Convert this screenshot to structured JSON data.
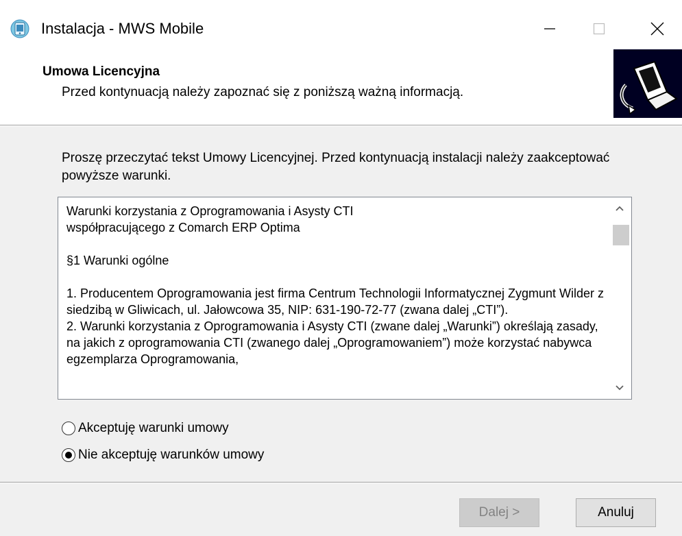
{
  "window": {
    "title": "Instalacja - MWS Mobile",
    "icon": "installer-app-icon",
    "controls": [
      "minimize-icon",
      "maximize-icon",
      "close-icon"
    ]
  },
  "header": {
    "title": "Umowa Licencyjna",
    "subtitle": "Przed kontynuacją należy zapoznać się z poniższą ważną informacją.",
    "image": "computer-install-icon"
  },
  "intro": "Proszę przeczytać tekst Umowy Licencyjnej. Przed kontynuacją instalacji należy zaakceptować powyższe warunki.",
  "license": {
    "text": "Warunki korzystania z Oprogramowania i Asysty CTI\nwspółpracującego z Comarch ERP Optima\n\n§1 Warunki ogólne\n\n1. Producentem Oprogramowania jest firma Centrum Technologii Informatycznej Zygmunt Wilder z siedzibą w Gliwicach, ul. Jałowcowa 35, NIP: 631-190-72-77 (zwana dalej „CTI”).\n2. Warunki korzystania z Oprogramowania i Asysty CTI (zwane dalej „Warunki”) określają zasady, na jakich z oprogramowania CTI (zwanego dalej „Oprogramowaniem”) może korzystać nabywca egzemplarza Oprogramowania,"
  },
  "options": {
    "accept_label": "Akceptuję warunki umowy",
    "decline_label": "Nie akceptuję warunków umowy",
    "selected": "decline"
  },
  "buttons": {
    "next_label": "Dalej >",
    "cancel_label": "Anuluj"
  },
  "colors": {
    "disabled_button": "#cccccc",
    "disabled_text": "#838383"
  }
}
